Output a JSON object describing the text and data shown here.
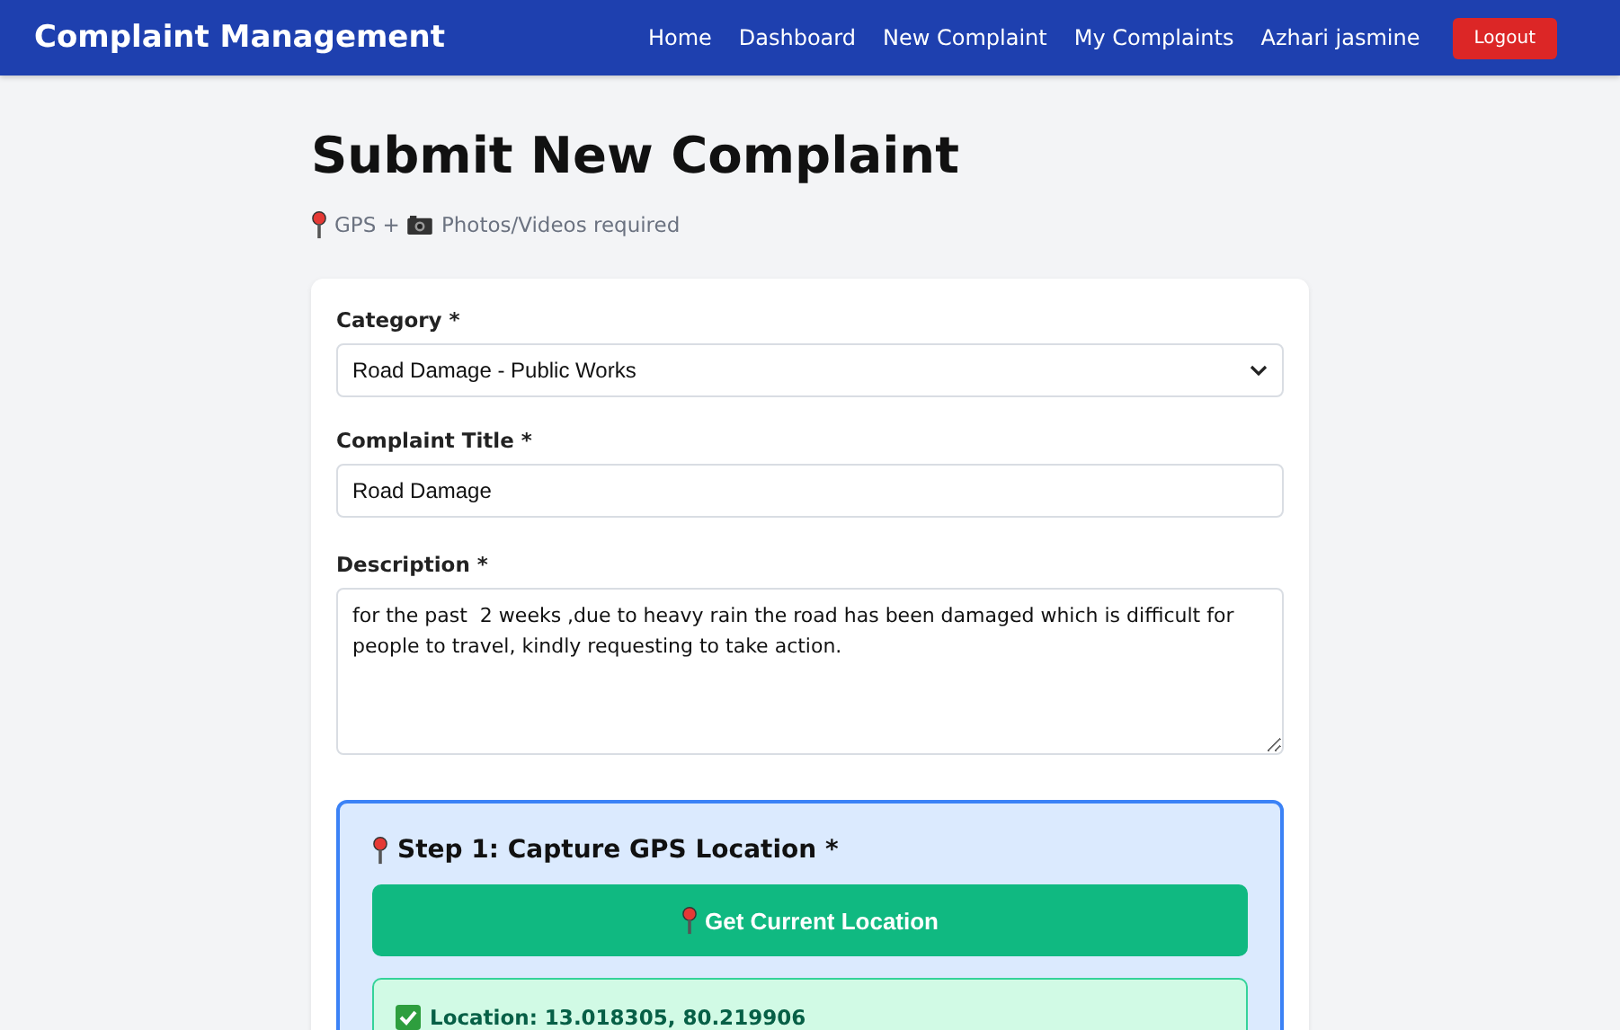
{
  "navbar": {
    "brand": "Complaint Management",
    "links": [
      {
        "label": "Home"
      },
      {
        "label": "Dashboard"
      },
      {
        "label": "New Complaint"
      },
      {
        "label": "My Complaints"
      }
    ],
    "user": "Azhari jasmine",
    "logout": "Logout"
  },
  "page": {
    "title": "Submit New Complaint",
    "subtitle_parts": [
      "GPS +",
      "Photos/Videos required"
    ]
  },
  "form": {
    "category": {
      "label": "Category *",
      "value": "Road Damage - Public Works"
    },
    "title": {
      "label": "Complaint Title *",
      "value": "Road Damage"
    },
    "description": {
      "label": "Description *",
      "value": "for the past  2 weeks ,due to heavy rain the road has been damaged which is difficult for people to travel, kindly requesting to take action."
    },
    "gps": {
      "heading": "Step 1: Capture GPS Location *",
      "button": "Get Current Location",
      "location": "Location: 13.018305, 80.219906"
    }
  }
}
